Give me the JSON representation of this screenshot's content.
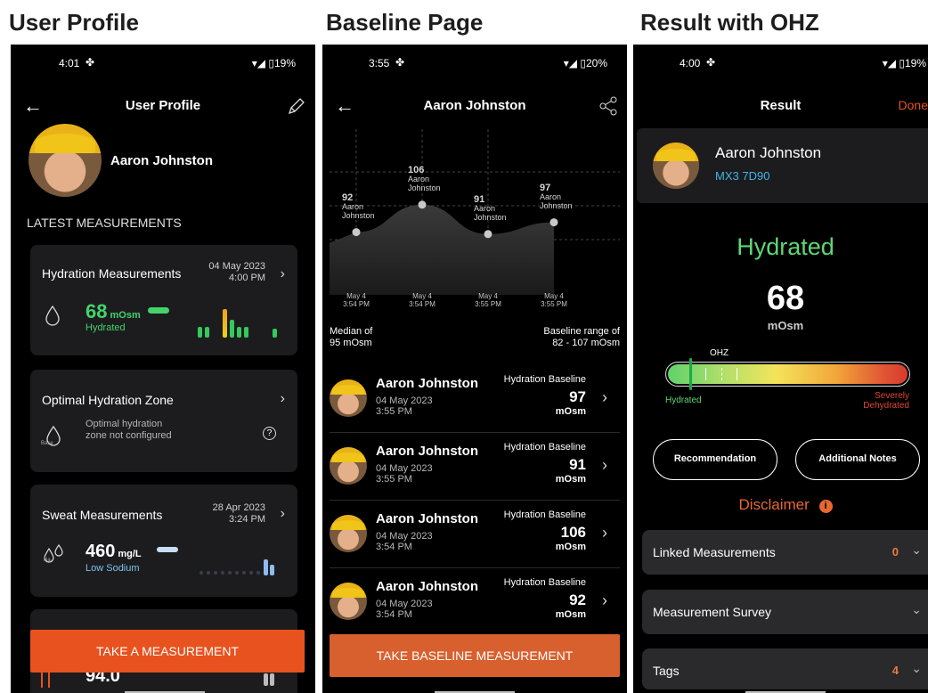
{
  "panels": {
    "p1_title": "User Profile",
    "p2_title": "Baseline Page",
    "p3_title": "Result with OHZ"
  },
  "phone1": {
    "status": {
      "time": "4:01",
      "battery": "19%"
    },
    "nav_title": "User Profile",
    "user_name": "Aaron Johnston",
    "section_title": "LATEST MEASUREMENTS",
    "hydration_card": {
      "title": "Hydration Measurements",
      "date": "04 May 2023",
      "time": "4:00 PM",
      "value": "68",
      "unit": "mOsm",
      "status": "Hydrated"
    },
    "ohz_card": {
      "title": "Optimal Hydration Zone",
      "message": "Optimal hydration zone not configured",
      "icon_label": "Base"
    },
    "sweat_card": {
      "title": "Sweat Measurements",
      "date": "28 Apr 2023",
      "time": "3:24 PM",
      "value": "460",
      "unit": "mg/L",
      "status": "Low Sodium",
      "icon_label": "Na"
    },
    "partial_card_value": "94.0",
    "cta": "TAKE A MEASUREMENT"
  },
  "phone2": {
    "status": {
      "time": "3:55",
      "battery": "20%"
    },
    "nav_title": "Aaron Johnston",
    "chart_data": {
      "type": "area",
      "x": [
        "May 4 3:54 PM",
        "May 4 3:54 PM",
        "May 4 3:55 PM",
        "May 4 3:55 PM"
      ],
      "series": [
        {
          "values": [
            92,
            106,
            91,
            97
          ]
        }
      ],
      "point_labels": [
        "Aaron Johnston",
        "Aaron Johnston",
        "Aaron Johnston",
        "Aaron Johnston"
      ],
      "x_ticks": [
        [
          "May 4",
          "3:54 PM"
        ],
        [
          "May 4",
          "3:54 PM"
        ],
        [
          "May 4",
          "3:55 PM"
        ],
        [
          "May 4",
          "3:55 PM"
        ]
      ],
      "ylim": [
        60,
        140
      ]
    },
    "median_line1": "Median of",
    "median_line2": "95 mOsm",
    "range_line1": "Baseline range of",
    "range_line2": "82 - 107 mOsm",
    "rows": [
      {
        "name": "Aaron Johnston",
        "date": "04 May 2023",
        "time": "3:55 PM",
        "type": "Hydration Baseline",
        "value": "97",
        "unit": "mOsm"
      },
      {
        "name": "Aaron Johnston",
        "date": "04 May 2023",
        "time": "3:55 PM",
        "type": "Hydration Baseline",
        "value": "91",
        "unit": "mOsm"
      },
      {
        "name": "Aaron Johnston",
        "date": "04 May 2023",
        "time": "3:54 PM",
        "type": "Hydration Baseline",
        "value": "106",
        "unit": "mOsm"
      },
      {
        "name": "Aaron Johnston",
        "date": "04 May 2023",
        "time": "3:54 PM",
        "type": "Hydration Baseline",
        "value": "92",
        "unit": "mOsm"
      }
    ],
    "cta": "TAKE BASELINE MEASUREMENT"
  },
  "phone3": {
    "status": {
      "time": "4:00",
      "battery": "19%"
    },
    "nav_title": "Result",
    "done": "Done",
    "user_name": "Aaron Johnston",
    "device_id": "MX3 7D90",
    "result_status": "Hydrated",
    "value": "68",
    "unit": "mOsm",
    "gauge_marker_label": "OHZ",
    "gauge_left": "Hydrated",
    "gauge_right1": "Severely",
    "gauge_right2": "Dehydrated",
    "btn_recommendation": "Recommendation",
    "btn_notes": "Additional Notes",
    "disclaimer": "Disclaimer",
    "accordions": [
      {
        "label": "Linked Measurements",
        "count": "0"
      },
      {
        "label": "Measurement Survey",
        "count": ""
      },
      {
        "label": "Tags",
        "count": "4"
      }
    ]
  },
  "colors": {
    "accent_orange": "#e8521f",
    "hydrated_green": "#43d36a",
    "link_blue": "#3fb6e6"
  }
}
